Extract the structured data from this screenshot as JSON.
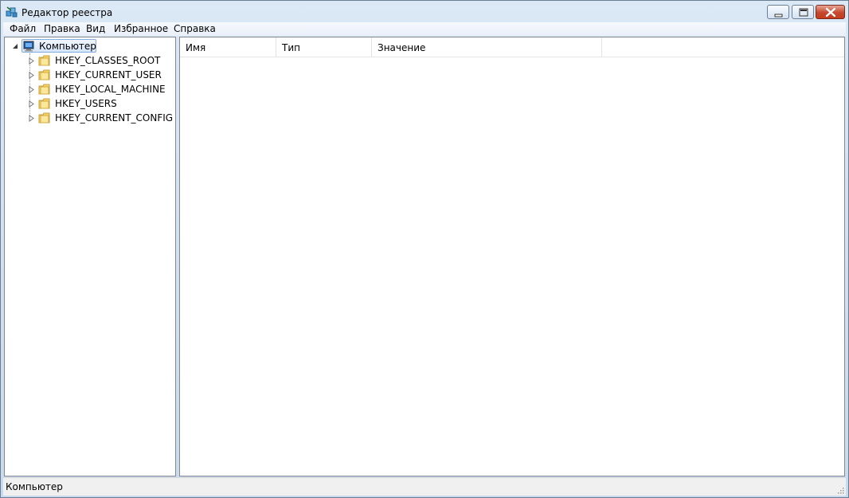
{
  "window": {
    "title": "Редактор реестра",
    "icon": "registry-editor-icon"
  },
  "menu": [
    "Файл",
    "Правка",
    "Вид",
    "Избранное",
    "Справка"
  ],
  "tree": {
    "root": {
      "label": "Компьютер",
      "icon": "computer-icon",
      "expanded": true,
      "selected": true
    },
    "keys": [
      {
        "label": "HKEY_CLASSES_ROOT",
        "icon": "folder-icon"
      },
      {
        "label": "HKEY_CURRENT_USER",
        "icon": "folder-icon"
      },
      {
        "label": "HKEY_LOCAL_MACHINE",
        "icon": "folder-icon"
      },
      {
        "label": "HKEY_USERS",
        "icon": "folder-icon"
      },
      {
        "label": "HKEY_CURRENT_CONFIG",
        "icon": "folder-icon"
      }
    ]
  },
  "list": {
    "columns": [
      "Имя",
      "Тип",
      "Значение"
    ]
  },
  "status": "Компьютер"
}
